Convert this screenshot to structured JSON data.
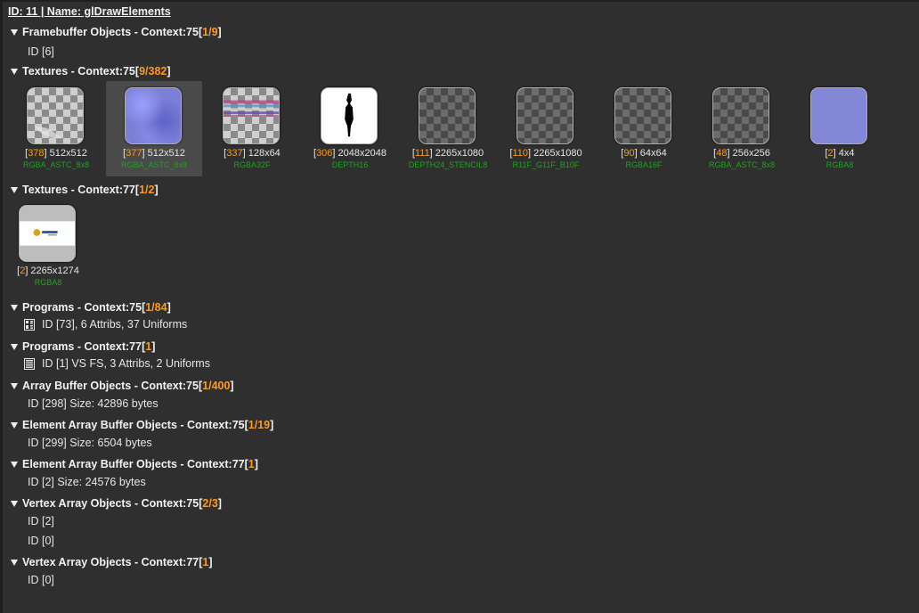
{
  "header": {
    "title": "ID: 11 | Name: glDrawElements"
  },
  "sections": {
    "fbo": {
      "label": "Framebuffer Objects - Context:75 ",
      "open": "[",
      "count": "1/9",
      "close": "]"
    },
    "tex75": {
      "label": "Textures - Context:75 ",
      "open": "[",
      "count": "9/382",
      "close": "]"
    },
    "tex77": {
      "label": "Textures - Context:77 ",
      "open": "[",
      "count": "1/2",
      "close": "]"
    },
    "prog75": {
      "label": "Programs - Context:75 ",
      "open": "[",
      "count": "1/84",
      "close": "]"
    },
    "prog77": {
      "label": "Programs - Context:77 ",
      "open": "[",
      "count": "1",
      "close": "]"
    },
    "abo75": {
      "label": "Array Buffer Objects - Context:75 ",
      "open": "[",
      "count": "1/400",
      "close": "]"
    },
    "ebo75": {
      "label": "Element Array Buffer Objects - Context:75 ",
      "open": "[",
      "count": "1/19",
      "close": "]"
    },
    "ebo77": {
      "label": "Element Array Buffer Objects - Context:77 ",
      "open": "[",
      "count": "1",
      "close": "]"
    },
    "vao75": {
      "label": "Vertex Array Objects - Context:75 ",
      "open": "[",
      "count": "2/3",
      "close": "]"
    },
    "vao77": {
      "label": "Vertex Array Objects - Context:77 ",
      "open": "[",
      "count": "1",
      "close": "]"
    }
  },
  "items": {
    "fbo_id": "ID [6]",
    "prog75_id": "ID [73], 6 Attribs, 37 Uniforms",
    "prog77_id": "ID [1] VS FS, 3 Attribs, 2 Uniforms",
    "abo75_id": "ID [298] Size: 42896 bytes",
    "ebo75_id": "ID [299] Size: 6504 bytes",
    "ebo77_id": "ID [2] Size: 24576 bytes",
    "vao75_id1": "ID [2]",
    "vao75_id2": "ID [0]",
    "vao77_id": "ID [0]"
  },
  "textures75": [
    {
      "id": "378",
      "size": " 512x512",
      "format": "RGBA_ASTC_8x8",
      "style": "light"
    },
    {
      "id": "377",
      "size": " 512x512",
      "format": "RGBA_ASTC_8x8",
      "style": "normal",
      "selected": true
    },
    {
      "id": "337",
      "size": " 128x64",
      "format": "RGBA32F",
      "style": "noise"
    },
    {
      "id": "306",
      "size": " 2048x2048",
      "format": "DEPTH16",
      "style": "white"
    },
    {
      "id": "111",
      "size": " 2265x1080",
      "format": "DEPTH24_STENCIL8",
      "style": "dark"
    },
    {
      "id": "110",
      "size": " 2265x1080",
      "format": "R11F_G11F_B10F",
      "style": "dark"
    },
    {
      "id": "90",
      "size": " 64x64",
      "format": "RGBA16F",
      "style": "dark"
    },
    {
      "id": "48",
      "size": " 256x256",
      "format": "RGBA_ASTC_8x8",
      "style": "dark"
    },
    {
      "id": "2",
      "size": " 4x4",
      "format": "RGBA8",
      "style": "lavender"
    }
  ],
  "textures77": [
    {
      "id": "2",
      "size": " 2265x1274",
      "format": "RGBA8",
      "style": "logo"
    }
  ],
  "colors": {
    "accent": "#ff9a1a",
    "format_green": "#1aa51a",
    "background": "#2f2f2f"
  }
}
